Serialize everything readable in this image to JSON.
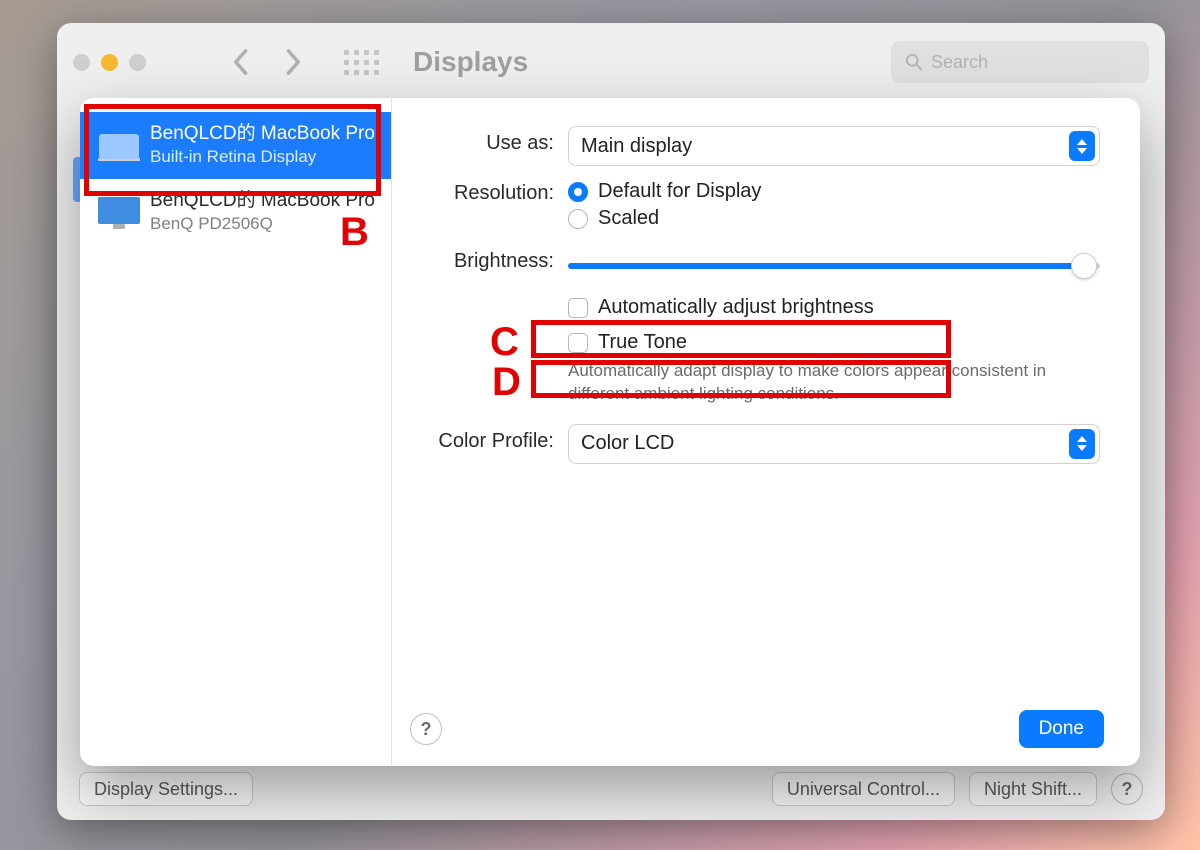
{
  "window": {
    "title": "Displays",
    "search_placeholder": "Search"
  },
  "background_buttons": {
    "display_settings": "Display Settings...",
    "universal_control": "Universal Control...",
    "night_shift": "Night Shift...",
    "help": "?"
  },
  "sidebar": {
    "items": [
      {
        "title": "BenQLCD的 MacBook Pro",
        "subtitle": "Built-in Retina Display",
        "selected": true,
        "type": "laptop"
      },
      {
        "title": "BenQLCD的 MacBook Pro",
        "subtitle": "BenQ PD2506Q",
        "selected": false,
        "type": "monitor"
      }
    ]
  },
  "labels": {
    "use_as": "Use as:",
    "resolution": "Resolution:",
    "brightness": "Brightness:",
    "color_profile": "Color Profile:"
  },
  "use_as": {
    "value": "Main display"
  },
  "resolution": {
    "default": "Default for Display",
    "scaled": "Scaled",
    "selected": "default"
  },
  "brightness": {
    "percent": 97
  },
  "checkboxes": {
    "auto_brightness": {
      "label": "Automatically adjust brightness",
      "checked": false
    },
    "true_tone": {
      "label": "True Tone",
      "checked": false,
      "desc": "Automatically adapt display to make colors appear consistent in different ambient lighting conditions."
    }
  },
  "color_profile": {
    "value": "Color LCD"
  },
  "footer": {
    "help": "?",
    "done": "Done"
  },
  "annotations": {
    "b": "B",
    "c": "C",
    "d": "D"
  }
}
